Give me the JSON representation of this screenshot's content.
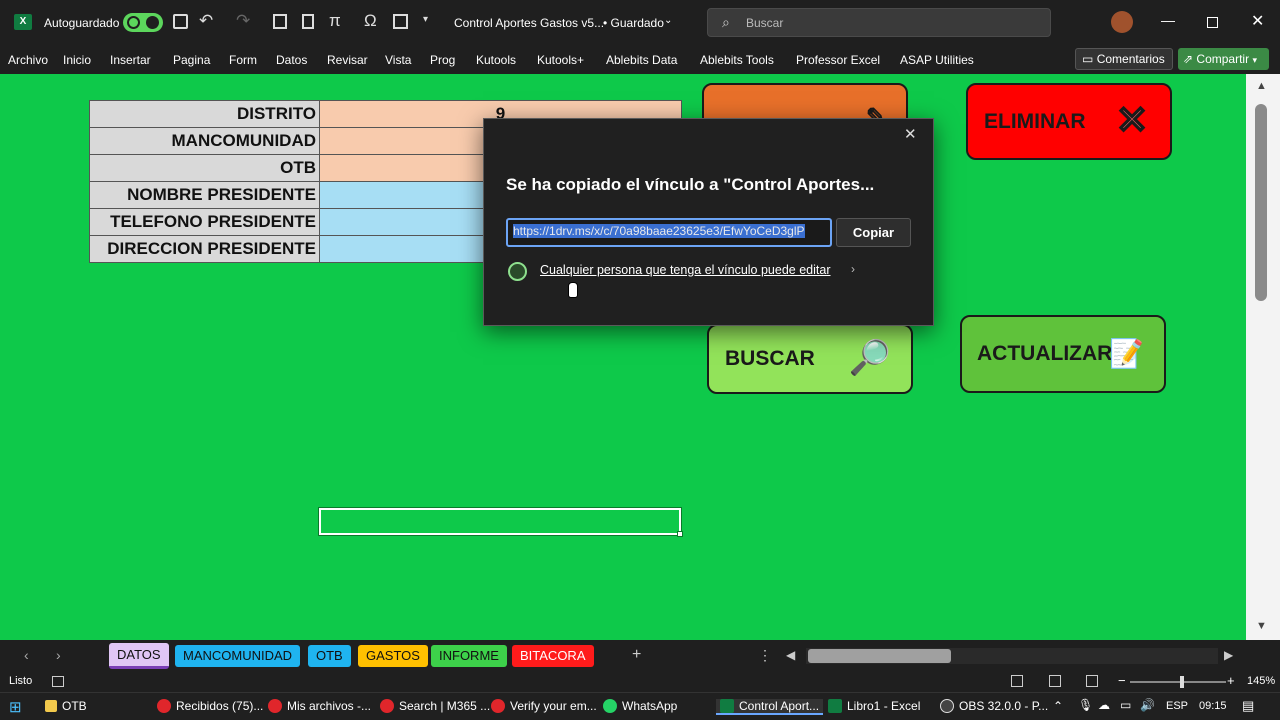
{
  "titlebar": {
    "autosave_label": "Autoguardado",
    "doc_title": "Control Aportes Gastos v5...",
    "saved_status": "• Guardado",
    "search_placeholder": "Buscar"
  },
  "ribbon": {
    "tabs": [
      "Archivo",
      "Inicio",
      "Insertar",
      "Pagina",
      "Form",
      "Datos",
      "Revisar",
      "Vista",
      "Prog",
      "Kutools",
      "Kutools+",
      "Ablebits Data",
      "Ablebits Tools",
      "Professor Excel",
      "ASAP Utilities"
    ],
    "comments_label": "Comentarios",
    "share_label": "Compartir"
  },
  "form": {
    "rows": [
      {
        "label": "DISTRITO",
        "value": "9"
      },
      {
        "label": "MANCOMUNIDAD",
        "value": ""
      },
      {
        "label": "OTB",
        "value": ""
      },
      {
        "label": "NOMBRE PRESIDENTE",
        "value": ""
      },
      {
        "label": "TELEFONO PRESIDENTE",
        "value": ""
      },
      {
        "label": "DIRECCION PRESIDENTE",
        "value": ""
      }
    ]
  },
  "buttons": {
    "eliminar": "ELIMINAR",
    "buscar": "BUSCAR",
    "actualizar": "ACTUALIZAR"
  },
  "dialog": {
    "title": "Se ha copiado el vínculo a \"Control Aportes...",
    "link_value": "https://1drv.ms/x/c/70a98baae23625e3/EfwYoCeD3glP",
    "copy_label": "Copiar",
    "permission_text": "Cualquier persona que tenga el vínculo puede editar"
  },
  "sheet_tabs": [
    {
      "label": "DATOS",
      "color": "#e0c6f5",
      "active": true
    },
    {
      "label": "MANCOMUNIDAD",
      "color": "#1fb4f0"
    },
    {
      "label": "OTB",
      "color": "#1fb4f0"
    },
    {
      "label": "GASTOS",
      "color": "#ffc000"
    },
    {
      "label": "INFORME",
      "color": "#3dd14a"
    },
    {
      "label": "BITACORA",
      "color": "#ff1b1b"
    }
  ],
  "status": {
    "ready": "Listo",
    "zoom": "145%"
  },
  "taskbar": {
    "items": [
      "OTB",
      "Recibidos (75)...",
      "Mis archivos -...",
      "Search | M365 ...",
      "Verify your em...",
      "WhatsApp",
      "Control Aport...",
      "Libro1 - Excel",
      "OBS 32.0.0 - P..."
    ],
    "lang": "ESP",
    "time": "09:15"
  },
  "colors": {
    "sheet_bg": "#0ec94a",
    "eliminar_bg": "#ff0000",
    "buscar_bg": "#92e35a",
    "actualizar_bg": "#5fc23b",
    "orange_btn": "#e8702a"
  }
}
